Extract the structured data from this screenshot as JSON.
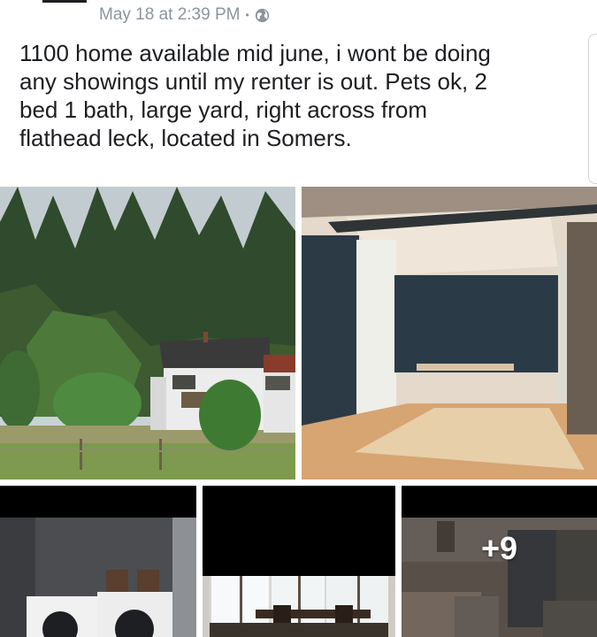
{
  "post": {
    "timestamp": "May 18 at 2:39 PM",
    "separator": "•",
    "privacy_icon": "globe-icon",
    "text_lines": [
      "1100 home available mid june, i wont be doing",
      "any showings until my renter is out. Pets ok, 2",
      "bed 1 bath, large  yard, right across from",
      "flathead leck, located in Somers."
    ]
  },
  "photos": {
    "more_count": "+9"
  },
  "colors": {
    "meta_text": "#8d949e",
    "body_text": "#1c1e21",
    "photo_gap": "#ffffff"
  }
}
